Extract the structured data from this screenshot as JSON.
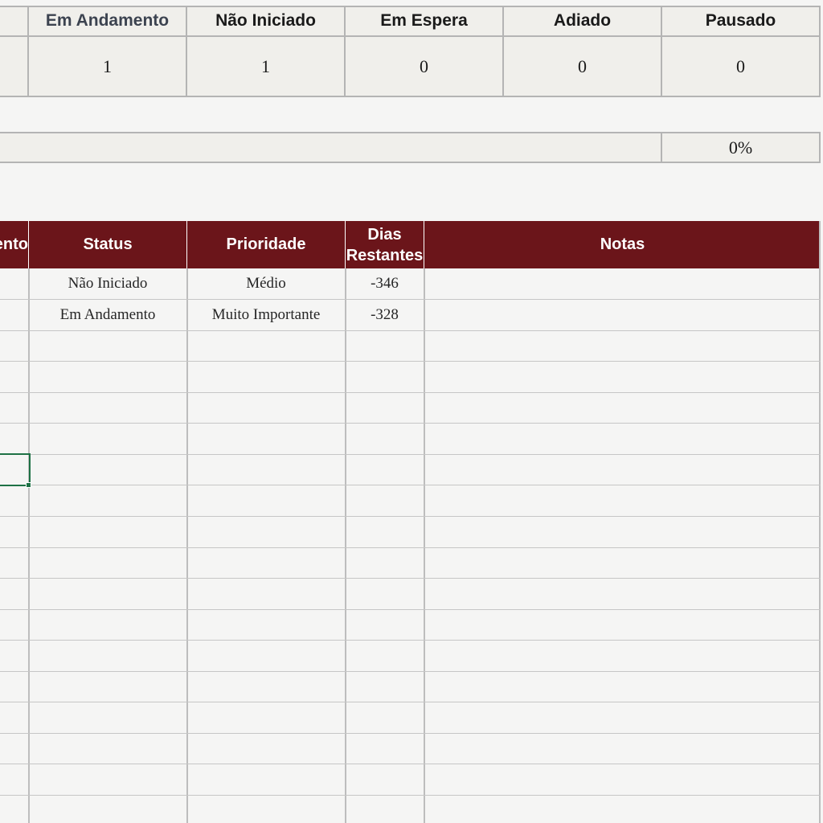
{
  "summary": {
    "headers": [
      "Em Andamento",
      "Não Iniciado",
      "Em Espera",
      "Adiado",
      "Pausado"
    ],
    "counts": [
      "1",
      "1",
      "0",
      "0",
      "0"
    ],
    "percent": "0%"
  },
  "table": {
    "headers": {
      "partial": "ento",
      "status": "Status",
      "priority": "Prioridade",
      "days_left": "Dias Restantes",
      "notes": "Notas"
    },
    "rows": [
      {
        "status": "Não Iniciado",
        "priority": "Médio",
        "days_left": "-346",
        "notes": ""
      },
      {
        "status": "Em Andamento",
        "priority": "Muito Importante",
        "days_left": "-328",
        "notes": ""
      }
    ]
  },
  "colors": {
    "header_bg": "#6b151a",
    "header_text": "#ffffff",
    "selection": "#1e7145",
    "summary_bg": "#f0efeb"
  }
}
